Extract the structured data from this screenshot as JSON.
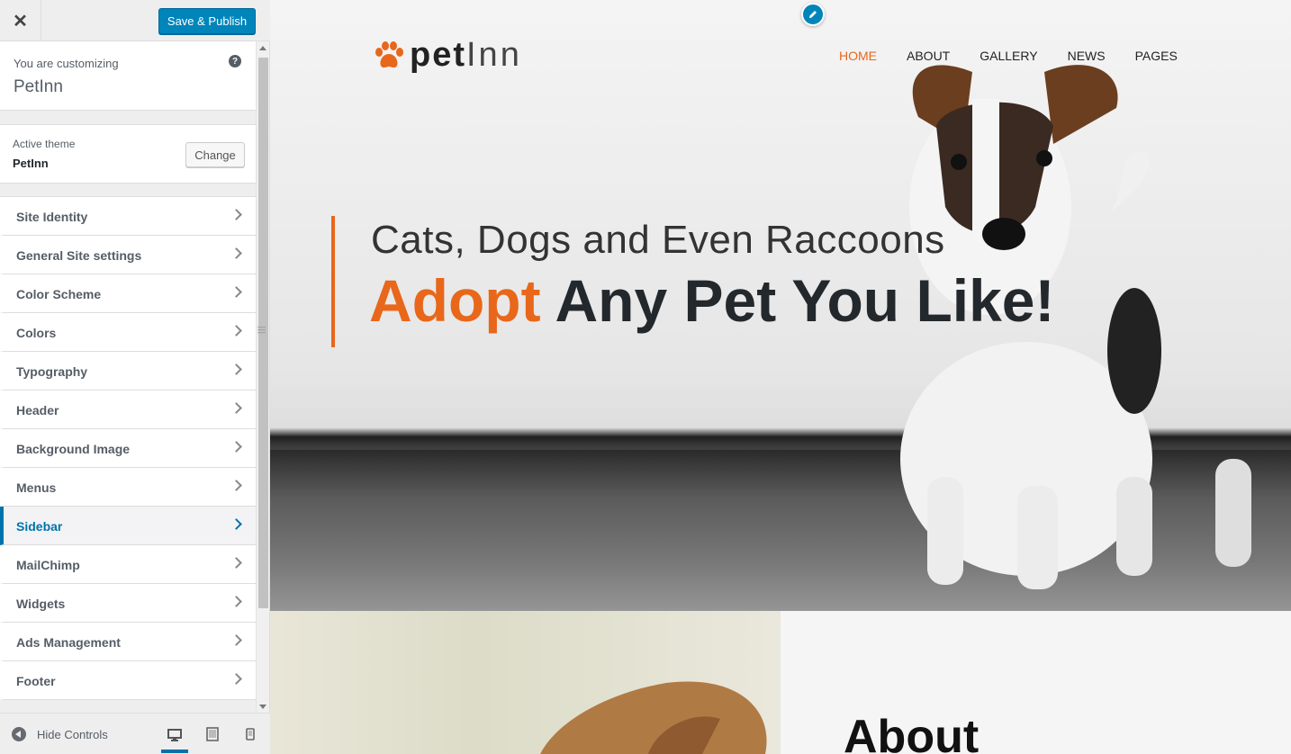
{
  "topbar": {
    "close": "✕",
    "publish": "Save & Publish"
  },
  "customizing": {
    "label": "You are customizing",
    "site": "PetInn",
    "help": "?"
  },
  "theme": {
    "label": "Active theme",
    "name": "PetInn",
    "change": "Change"
  },
  "sections": [
    {
      "label": "Site Identity"
    },
    {
      "label": "General Site settings"
    },
    {
      "label": "Color Scheme"
    },
    {
      "label": "Colors"
    },
    {
      "label": "Typography"
    },
    {
      "label": "Header"
    },
    {
      "label": "Background Image"
    },
    {
      "label": "Menus"
    },
    {
      "label": "Sidebar",
      "active": true
    },
    {
      "label": "MailChimp"
    },
    {
      "label": "Widgets"
    },
    {
      "label": "Ads Management"
    },
    {
      "label": "Footer"
    }
  ],
  "bottombar": {
    "hide": "Hide Controls",
    "devices": [
      "desktop-icon",
      "tablet-icon",
      "mobile-icon"
    ]
  },
  "site": {
    "logo_pet": "pet",
    "logo_inn": "Inn",
    "nav": [
      "HOME",
      "ABOUT",
      "GALLERY",
      "NEWS",
      "PAGES"
    ],
    "hero_sub": "Cats, Dogs and Even Raccoons",
    "hero_title_accent": "Adopt",
    "hero_title_rest": "Any Pet You Like!",
    "about": "About"
  },
  "colors": {
    "accent": "#e8671b",
    "wp_blue": "#0085ba",
    "active_section": "#0073aa"
  }
}
